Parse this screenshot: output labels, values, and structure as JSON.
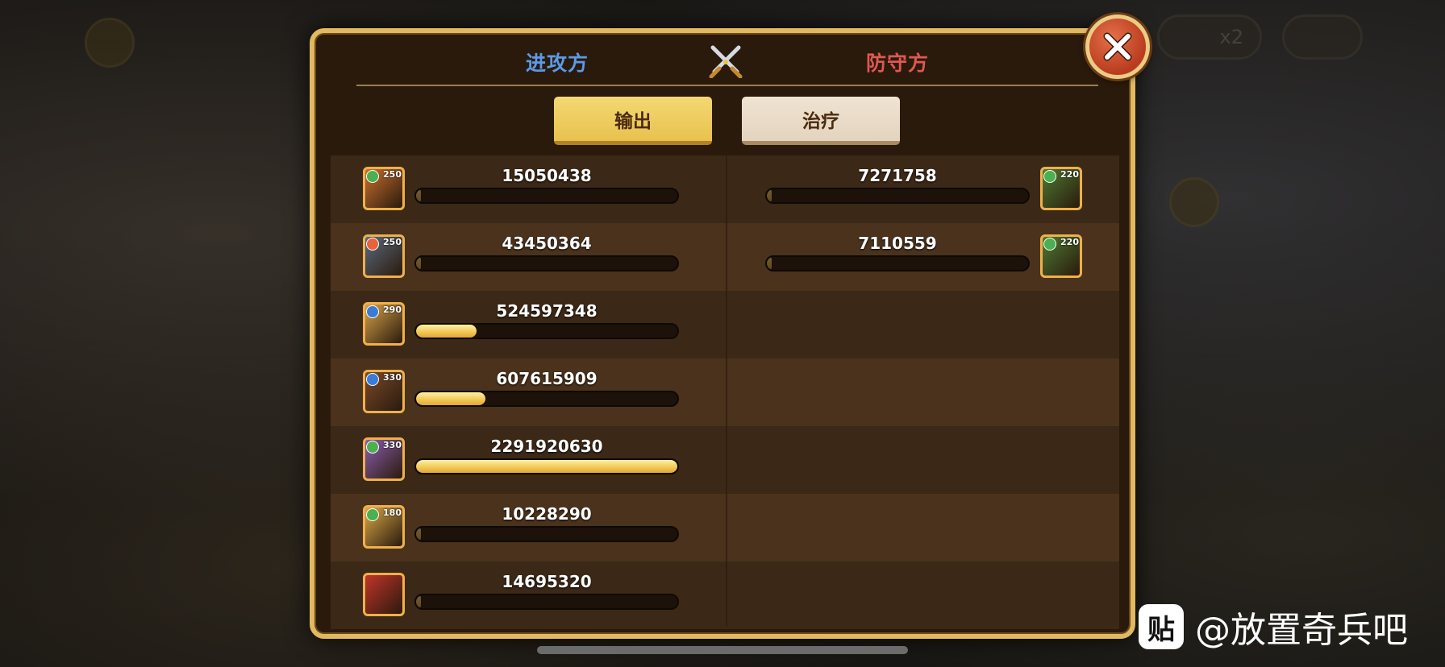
{
  "header": {
    "attacker_label": "进攻方",
    "defender_label": "防守方"
  },
  "tabs": {
    "output_label": "输出",
    "heal_label": "治疗",
    "active": "输出"
  },
  "attackers": [
    {
      "level": "250",
      "value": "15050438",
      "bar_fraction": 0.0,
      "element_color": "#4caf50",
      "avatar_color": "#c9702e"
    },
    {
      "level": "250",
      "value": "43450364",
      "bar_fraction": 0.0,
      "element_color": "#e8623a",
      "avatar_color": "#5a6a7e"
    },
    {
      "level": "290",
      "value": "524597348",
      "bar_fraction": 0.23,
      "element_color": "#3a7bd5",
      "avatar_color": "#d8a24a"
    },
    {
      "level": "330",
      "value": "607615909",
      "bar_fraction": 0.265,
      "element_color": "#3a7bd5",
      "avatar_color": "#7a4a2a"
    },
    {
      "level": "330",
      "value": "2291920630",
      "bar_fraction": 1.0,
      "element_color": "#4caf50",
      "avatar_color": "#8b5db0"
    },
    {
      "level": "180",
      "value": "10228290",
      "bar_fraction": 0.0,
      "element_color": "#4caf50",
      "avatar_color": "#d9a847"
    },
    {
      "level": "",
      "value": "14695320",
      "bar_fraction": 0.0,
      "element_color": "",
      "avatar_color": "#c0352a"
    }
  ],
  "defenders": [
    {
      "level": "220",
      "value": "7271758",
      "bar_fraction": 0.0,
      "element_color": "#4caf50",
      "avatar_color": "#4f7a32"
    },
    {
      "level": "220",
      "value": "7110559",
      "bar_fraction": 0.0,
      "element_color": "#4caf50",
      "avatar_color": "#4f7a32"
    }
  ],
  "background": {
    "speed_label": "x2"
  },
  "watermark": {
    "logo_char": "贴",
    "text": "@放置奇兵吧"
  },
  "icons": {
    "close": "close-icon",
    "swords": "crossed-swords-icon"
  }
}
